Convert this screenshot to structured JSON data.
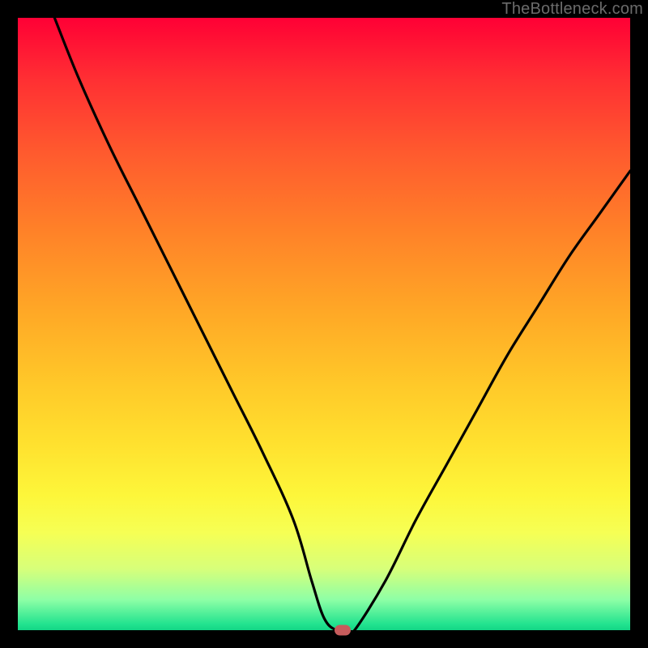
{
  "watermark": "TheBottleneck.com",
  "chart_data": {
    "type": "line",
    "title": "",
    "xlabel": "",
    "ylabel": "",
    "xlim": [
      0,
      100
    ],
    "ylim": [
      0,
      100
    ],
    "series": [
      {
        "name": "bottleneck-curve",
        "x": [
          6,
          10,
          15,
          20,
          25,
          30,
          35,
          40,
          45,
          48,
          50,
          52,
          54,
          55,
          60,
          65,
          70,
          75,
          80,
          85,
          90,
          95,
          100
        ],
        "y": [
          100,
          90,
          79,
          69,
          59,
          49,
          39,
          29,
          18,
          8,
          2,
          0,
          0,
          0,
          8,
          18,
          27,
          36,
          45,
          53,
          61,
          68,
          75
        ]
      }
    ],
    "marker": {
      "x": 53,
      "y": 0,
      "color": "#c75c5c"
    },
    "background_gradient": {
      "top": "#ff0035",
      "bottom": "#13d685"
    }
  }
}
